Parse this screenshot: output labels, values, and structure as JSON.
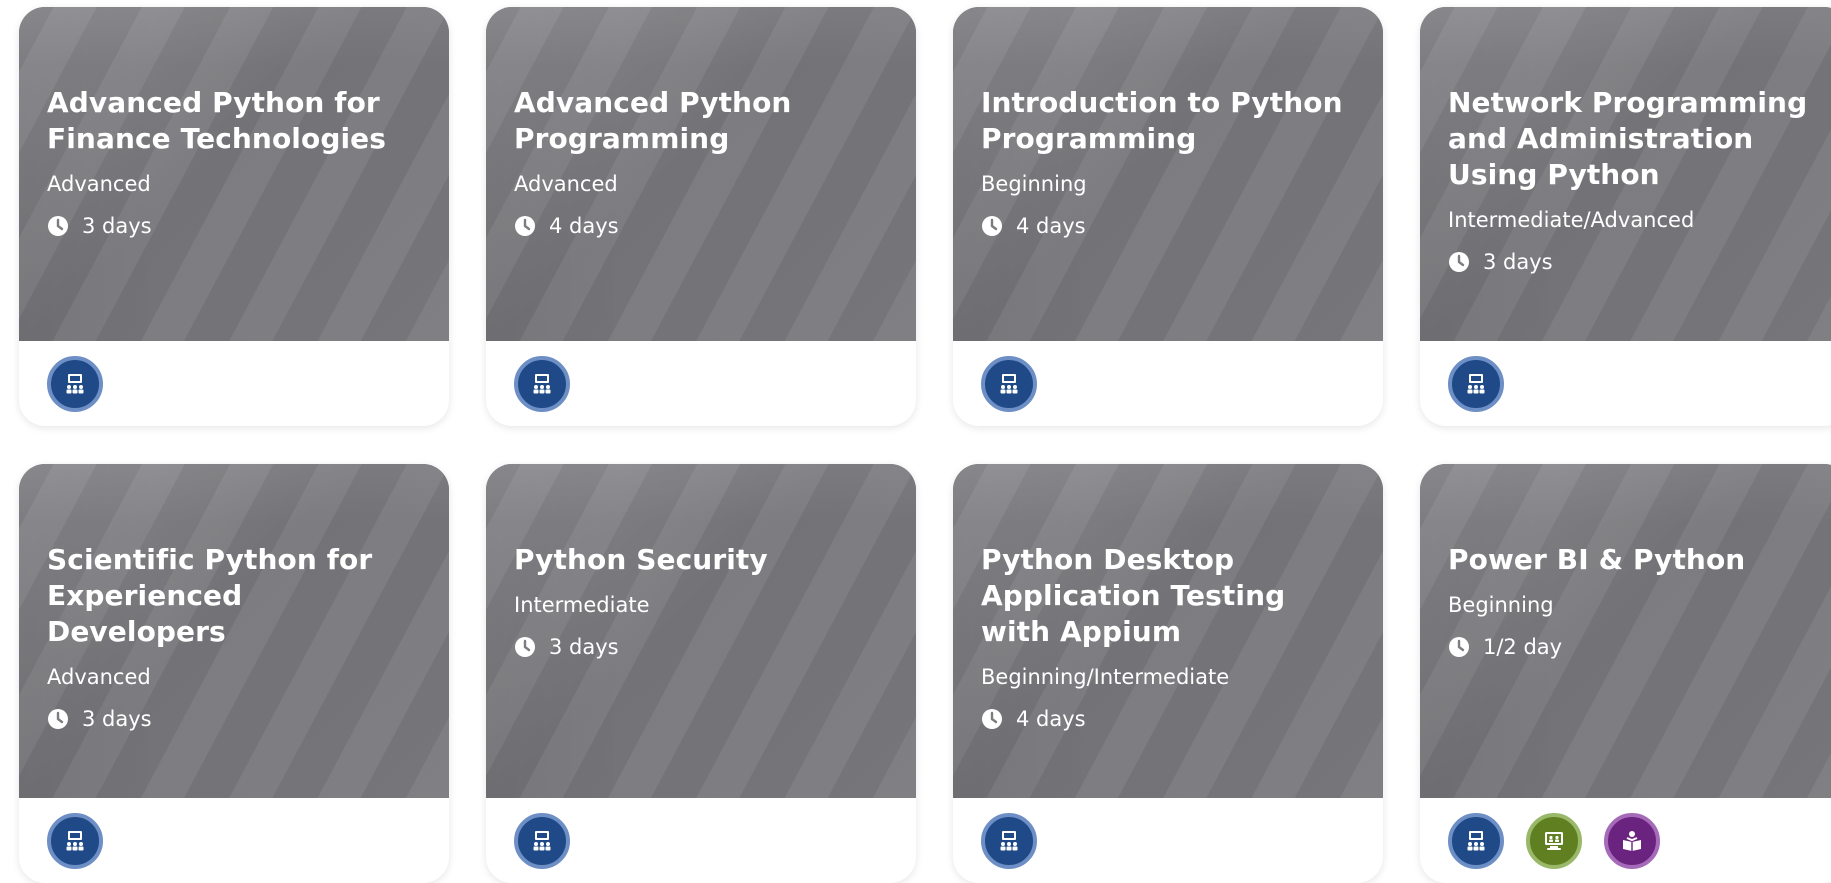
{
  "courses": [
    {
      "title": "Advanced Python for Finance Technologies",
      "level": "Advanced",
      "duration": "3 days",
      "delivery_icons": [
        "classroom-icon"
      ]
    },
    {
      "title": "Advanced Python Programming",
      "level": "Advanced",
      "duration": "4 days",
      "delivery_icons": [
        "classroom-icon"
      ]
    },
    {
      "title": "Introduction to Python Programming",
      "level": "Beginning",
      "duration": "4 days",
      "delivery_icons": [
        "classroom-icon"
      ]
    },
    {
      "title": "Network Programming and Administration Using Python",
      "level": "Intermediate/Advanced",
      "duration": "3 days",
      "delivery_icons": [
        "classroom-icon"
      ]
    },
    {
      "title": "Scientific Python for Experienced Developers",
      "level": "Advanced",
      "duration": "3 days",
      "delivery_icons": [
        "classroom-icon"
      ]
    },
    {
      "title": "Python Security",
      "level": "Intermediate",
      "duration": "3 days",
      "delivery_icons": [
        "classroom-icon"
      ]
    },
    {
      "title": "Python Desktop Application Testing with Appium",
      "level": "Beginning/Intermediate",
      "duration": "4 days",
      "delivery_icons": [
        "classroom-icon"
      ]
    },
    {
      "title": "Power BI & Python",
      "level": "Beginning",
      "duration": "1/2 day",
      "delivery_icons": [
        "classroom-icon",
        "virtual-classroom-icon",
        "self-paced-icon"
      ]
    }
  ],
  "colors": {
    "card_header": "#7c7c80",
    "classroom_badge": "#1f4a87",
    "virtual_badge": "#5f7f21",
    "selfpaced_badge": "#6b2380"
  }
}
